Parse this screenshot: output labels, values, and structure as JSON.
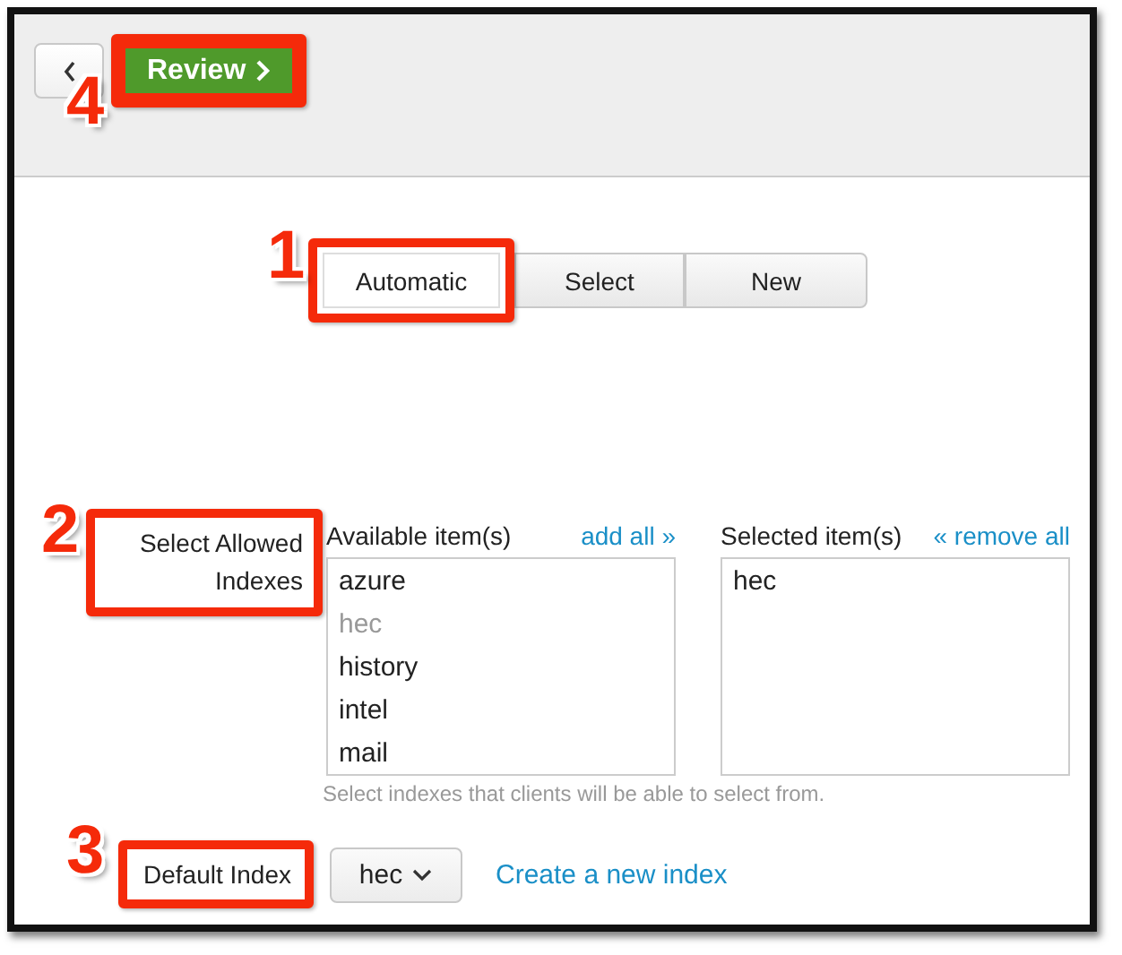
{
  "toolbar": {
    "review_button": {
      "label": "Review",
      "callout": "4"
    }
  },
  "tabs": [
    {
      "label": "Automatic",
      "selected": true,
      "callout": "1"
    },
    {
      "label": "Select",
      "selected": false
    },
    {
      "label": "New",
      "selected": false
    }
  ],
  "allowed_indexes": {
    "label": "Select Allowed Indexes",
    "callout": "2",
    "available": {
      "heading": "Available item(s)",
      "action": "add all »",
      "items": [
        {
          "label": "azure",
          "disabled": false
        },
        {
          "label": "hec",
          "disabled": true
        },
        {
          "label": "history",
          "disabled": false
        },
        {
          "label": "intel",
          "disabled": false
        },
        {
          "label": "mail",
          "disabled": false
        }
      ]
    },
    "selected": {
      "heading": "Selected item(s)",
      "action": "« remove all",
      "items": [
        {
          "label": "hec"
        }
      ]
    },
    "help": "Select indexes that clients will be able to select from."
  },
  "default_index": {
    "label": "Default Index",
    "callout": "3",
    "value": "hec",
    "link": "Create a new index"
  }
}
